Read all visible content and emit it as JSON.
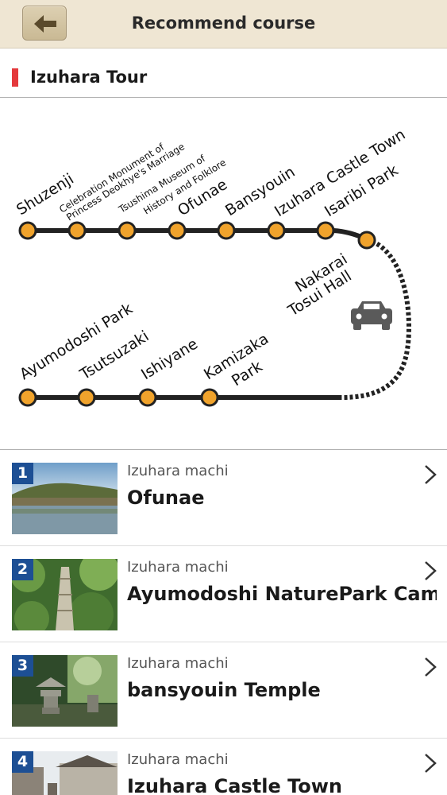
{
  "header": {
    "title": "Recommend course",
    "back_icon": "back-arrow-icon"
  },
  "course": {
    "title": "Izuhara Tour",
    "marker_color": "#e4393c"
  },
  "route_map": {
    "line_color": "#222222",
    "stop_color": "#f0a32c",
    "top_stops": [
      "Shuzenji",
      "Celebration Monument of Princess Deokhye's Marriage",
      "Tsushima Museum of History and Folklore",
      "Ofunae",
      "Bansyouin",
      "Izuhara Castle Town",
      "Isaribi Park"
    ],
    "bottom_stops": [
      "Ayumodoshi Park",
      "Tsutsuzaki",
      "Ishiyane",
      "Kamizaka Park"
    ],
    "labels": {
      "shuzenji": "Shuzenji",
      "celebration_1": "Celebration Monument of",
      "celebration_2": "Princess Deokhye's Marriage",
      "museum_1": "Tsushima Museum of",
      "museum_2": "History and Folklore",
      "ofunae": "Ofunae",
      "bansyouin": "Bansyouin",
      "castle_town": "Izuhara Castle Town",
      "isaribi": "Isaribi Park",
      "nakarai_1": "Nakarai",
      "nakarai_2": "Tosui Hall",
      "ayumodoshi": "Ayumodoshi Park",
      "tsutsuzaki": "Tsutsuzaki",
      "ishiyane": "Ishiyane",
      "kamizaka_1": "Kamizaka",
      "kamizaka_2": "Park"
    },
    "car_icon": "car-icon"
  },
  "spots": [
    {
      "number": "1",
      "area": "Izuhara machi",
      "name": "Ofunae"
    },
    {
      "number": "2",
      "area": "Izuhara machi",
      "name": "Ayumodoshi NaturePark Cam..."
    },
    {
      "number": "3",
      "area": "Izuhara machi",
      "name": "bansyouin Temple"
    },
    {
      "number": "4",
      "area": "Izuhara machi",
      "name": "Izuhara Castle Town"
    }
  ],
  "colors": {
    "header_bg": "#efe6d3",
    "badge_bg": "#1d4f94"
  }
}
